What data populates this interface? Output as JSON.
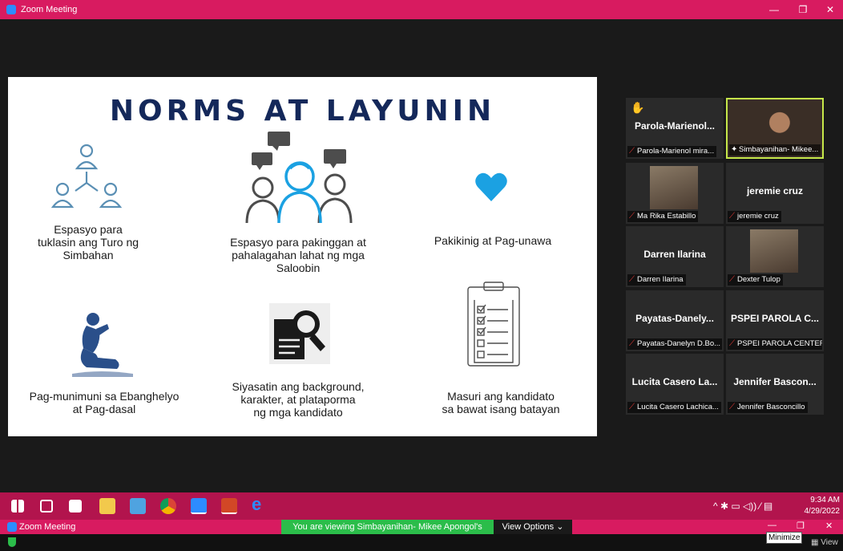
{
  "window": {
    "title": "Zoom Meeting",
    "minimize": "—",
    "restore": "❐",
    "close": "✕"
  },
  "slide": {
    "title": "NORMS AT LAYUNIN",
    "items": [
      {
        "label": "Espasyo para\ntuklasin ang Turo ng\nSimbahan"
      },
      {
        "label": "Espasyo para pakinggan at\npahalagahan lahat ng mga\nSaloobin"
      },
      {
        "label": "Pakikinig at Pag-unawa"
      },
      {
        "label": "Pag-munimuni sa Ebanghelyo\nat Pag-dasal"
      },
      {
        "label": "Siyasatin ang background,\nkarakter, at plataporma\nng mga kandidato"
      },
      {
        "label": "Masuri ang kandidato\nsa bawat isang batayan"
      }
    ]
  },
  "participants": [
    {
      "name": "Parola-Marienol...",
      "label": "Parola-Marienol mira...",
      "hand": "✋"
    },
    {
      "name": "",
      "label": "Simbayanihan- Mikee...",
      "active": true
    },
    {
      "name": "",
      "label": "Ma Rika Estabillo"
    },
    {
      "name": "jeremie cruz",
      "label": "jeremie cruz"
    },
    {
      "name": "Darren Ilarina",
      "label": "Darren Ilarina"
    },
    {
      "name": "",
      "label": "Dexter Tulop"
    },
    {
      "name": "Payatas-Danely...",
      "label": "Payatas-Danelyn D.Bo..."
    },
    {
      "name": "PSPEI PAROLA C...",
      "label": "PSPEI PAROLA CENTER"
    },
    {
      "name": "Lucita Casero La...",
      "label": "Lucita Casero Lachica..."
    },
    {
      "name": "Jennifer Bascon...",
      "label": "Jennifer Basconcillo"
    }
  ],
  "taskbar": {
    "time": "9:34 AM",
    "date": "4/29/2022",
    "tray": "^ ✱ ▭ ◁)) ⁄ ▤"
  },
  "zoom_toolbar": {
    "title": "Zoom Meeting",
    "viewing": "You are viewing Simbayanihan- Mikee Apongol's screen",
    "view_options": "View Options ⌄",
    "tooltip": "Minimize",
    "view": "View"
  },
  "colors": {
    "brand": "#d81b60",
    "slide_title": "#14285a",
    "accent_blue": "#1ba1e2",
    "banner_green": "#2bbd4a"
  }
}
